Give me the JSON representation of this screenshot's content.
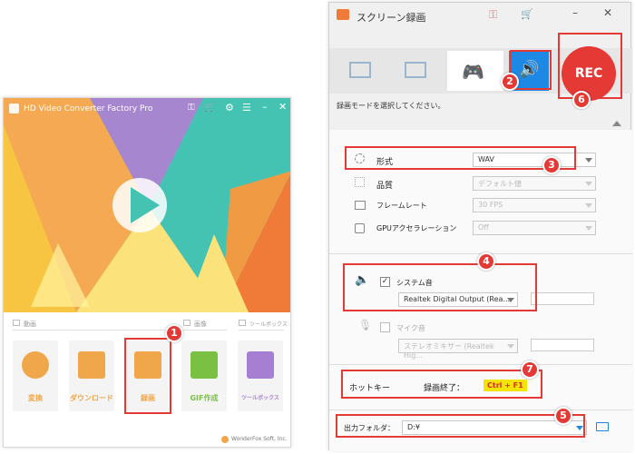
{
  "left_app": {
    "title": "HD Video Converter Factory Pro",
    "sections": {
      "video": "動画",
      "image": "画像",
      "toolbox": "ツールボックス"
    },
    "tiles": [
      {
        "label": "変換",
        "color": "#f0a64a"
      },
      {
        "label": "ダウンロード",
        "color": "#f0a64a"
      },
      {
        "label": "録画",
        "color": "#f0a64a"
      },
      {
        "label": "GIF作成",
        "color": "#7ac143"
      },
      {
        "label": "ツールボックス",
        "color": "#a77fd2"
      }
    ],
    "footer": "WonderFox Soft, Inc."
  },
  "right_app": {
    "title": "スクリーン録画",
    "rec_label": "REC",
    "mode_hint": "録画モードを選択してください。",
    "format": {
      "label": "形式",
      "value": "WAV"
    },
    "quality": {
      "label": "品質",
      "value": "デフォルト値"
    },
    "framerate": {
      "label": "フレームレート",
      "value": "30 FPS"
    },
    "gpu": {
      "label": "GPUアクセラレーション",
      "value": "Off"
    },
    "system_audio": {
      "label": "システム音",
      "device": "Realtek Digital Output (Rea..."
    },
    "mic": {
      "label": "マイク音",
      "device": "ステレオミキサー (Realtek Hig..."
    },
    "hotkey": {
      "label": "ホットキー",
      "action": "録画終了：",
      "keys": "Ctrl + F1"
    },
    "output": {
      "label": "出力フォルダ：",
      "value": "D:¥"
    }
  },
  "markers": [
    "1",
    "2",
    "3",
    "4",
    "5",
    "6",
    "7"
  ],
  "colors": {
    "accent_red": "#e53935",
    "hotkey_yellow": "#f5e400",
    "left_bg_top": "#45c3b2"
  }
}
